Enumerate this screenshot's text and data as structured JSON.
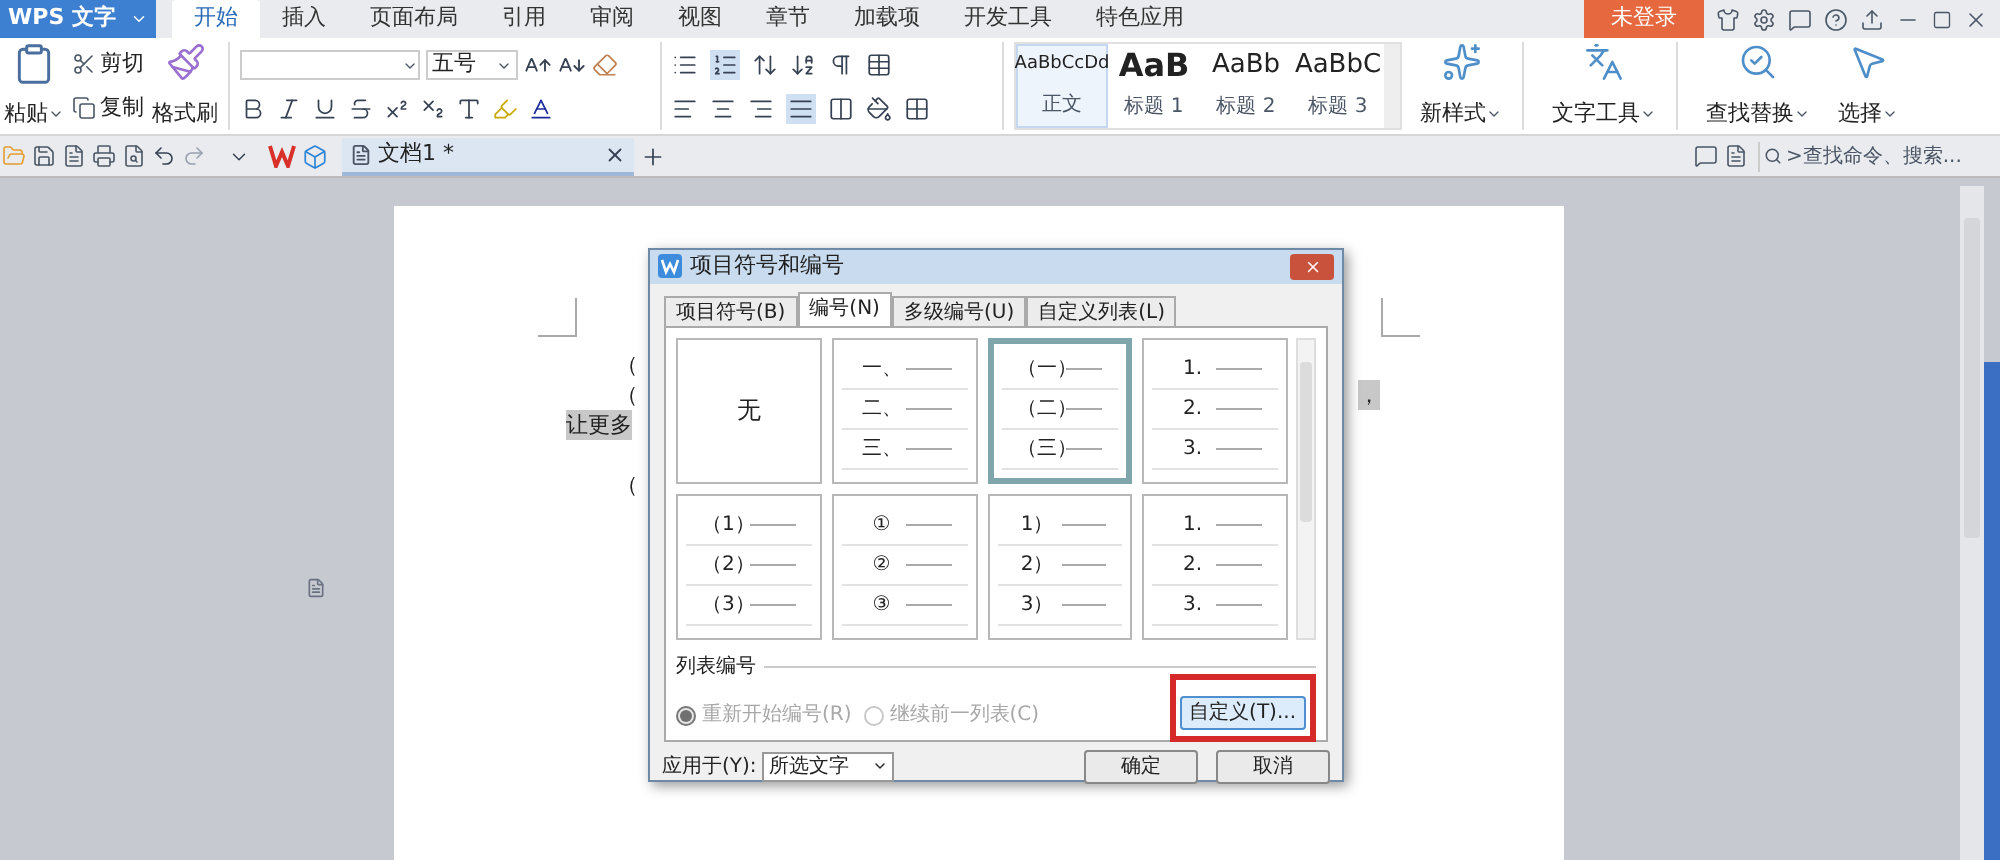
{
  "app_button": "WPS 文字",
  "tabs": [
    {
      "label": "开始",
      "selected": true
    },
    {
      "label": "插入",
      "selected": false
    },
    {
      "label": "页面布局",
      "selected": false
    },
    {
      "label": "引用",
      "selected": false
    },
    {
      "label": "审阅",
      "selected": false
    },
    {
      "label": "视图",
      "selected": false
    },
    {
      "label": "章节",
      "selected": false
    },
    {
      "label": "加载项",
      "selected": false
    },
    {
      "label": "开发工具",
      "selected": false
    },
    {
      "label": "特色应用",
      "selected": false
    }
  ],
  "login_button": "未登录",
  "clipboard": {
    "paste": "粘贴",
    "cut": "剪切",
    "copy": "复制",
    "format_painter": "格式刷"
  },
  "font_size": "五号",
  "styles": [
    {
      "preview": "AaBbCcDd",
      "label": "正文",
      "selected": true
    },
    {
      "preview": "AaB",
      "label": "标题 1",
      "selected": false
    },
    {
      "preview": "AaBb",
      "label": "标题 2",
      "selected": false
    },
    {
      "preview": "AaBbC",
      "label": "标题 3",
      "selected": false
    }
  ],
  "ribbon_buttons": [
    {
      "kind": "new_style",
      "label": "新样式"
    },
    {
      "kind": "text_tools",
      "label": "文字工具"
    },
    {
      "kind": "find_replace",
      "label": "查找替换"
    },
    {
      "kind": "select",
      "label": "选择"
    }
  ],
  "doc_tab": "文档1 *",
  "search": {
    "placeholder": ">查找命令、搜索..."
  },
  "document": {
    "lines": [
      {
        "left": "（",
        "highlighted": false
      },
      {
        "left": "（",
        "right": "，",
        "highlighted": false
      },
      {
        "left": "让更多",
        "highlighted": true
      },
      {
        "left": "（",
        "highlighted": false
      }
    ]
  },
  "dialog": {
    "title": "项目符号和编号",
    "tabs": [
      {
        "label": "项目符号(B)",
        "selected": false
      },
      {
        "label": "编号(N)",
        "selected": true
      },
      {
        "label": "多级编号(U)",
        "selected": false
      },
      {
        "label": "自定义列表(L)",
        "selected": false
      }
    ],
    "options": [
      {
        "kind": "none",
        "label": "无",
        "selected": false
      },
      {
        "kind": "list",
        "markers": [
          "一、",
          "二、",
          "三、"
        ],
        "selected": false
      },
      {
        "kind": "list",
        "markers": [
          "（一）",
          "（二）",
          "（三）"
        ],
        "selected": true
      },
      {
        "kind": "list",
        "markers": [
          "1.",
          "2.",
          "3."
        ],
        "selected": false
      },
      {
        "kind": "list",
        "markers": [
          "（1）",
          "（2）",
          "（3）"
        ],
        "selected": false
      },
      {
        "kind": "list",
        "markers": [
          "①",
          "②",
          "③"
        ],
        "selected": false
      },
      {
        "kind": "list",
        "markers": [
          "1）",
          "2）",
          "3）"
        ],
        "selected": false
      },
      {
        "kind": "list",
        "markers": [
          "1.",
          "2.",
          "3."
        ],
        "selected": false
      }
    ],
    "section_label": "列表编号",
    "radios": [
      {
        "label": "重新开始编号(R)",
        "selected": true,
        "disabled": true
      },
      {
        "label": "继续前一列表(C)",
        "selected": false,
        "disabled": true
      }
    ],
    "customize_button": "自定义(T)...",
    "apply_label": "应用于(Y):",
    "apply_value": "所选文字",
    "ok": "确定",
    "cancel": "取消"
  }
}
